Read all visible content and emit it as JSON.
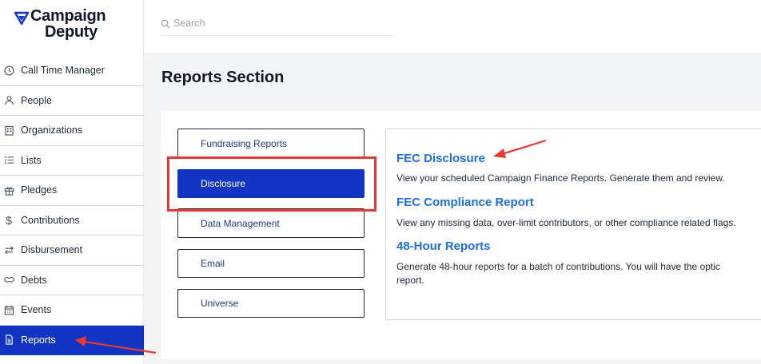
{
  "app": {
    "logo_line1": "Campaign",
    "logo_line2": "Deputy"
  },
  "search": {
    "placeholder": "Search"
  },
  "sidebar": {
    "items": [
      {
        "label": "Call Time Manager",
        "icon": "clock-icon"
      },
      {
        "label": "People",
        "icon": "person-icon"
      },
      {
        "label": "Organizations",
        "icon": "building-icon"
      },
      {
        "label": "Lists",
        "icon": "list-icon"
      },
      {
        "label": "Pledges",
        "icon": "gift-icon"
      },
      {
        "label": "Contributions",
        "icon": "dollar-icon"
      },
      {
        "label": "Disbursement",
        "icon": "transfer-icon"
      },
      {
        "label": "Debts",
        "icon": "handshake-icon"
      },
      {
        "label": "Events",
        "icon": "calendar-icon"
      },
      {
        "label": "Reports",
        "icon": "document-icon",
        "active": true
      }
    ]
  },
  "main": {
    "title": "Reports Section",
    "tabs": [
      {
        "label": "Fundraising Reports"
      },
      {
        "label": "Disclosure",
        "active": true
      },
      {
        "label": "Data Management"
      },
      {
        "label": "Email"
      },
      {
        "label": "Universe"
      }
    ],
    "reports": [
      {
        "title": "FEC Disclosure",
        "description": "View your scheduled Campaign Finance Reports. Generate them and review."
      },
      {
        "title": "FEC Compliance Report",
        "description": "View any missing data, over-limit contributors, or other compliance related flags."
      },
      {
        "title": "48-Hour Reports",
        "description": "Generate 48-hour reports for a batch of contributions. You will have the optic",
        "description2": "report."
      }
    ]
  },
  "colors": {
    "accent": "#1234c2",
    "link": "#1d6fe0",
    "annotation": "#e53935"
  }
}
